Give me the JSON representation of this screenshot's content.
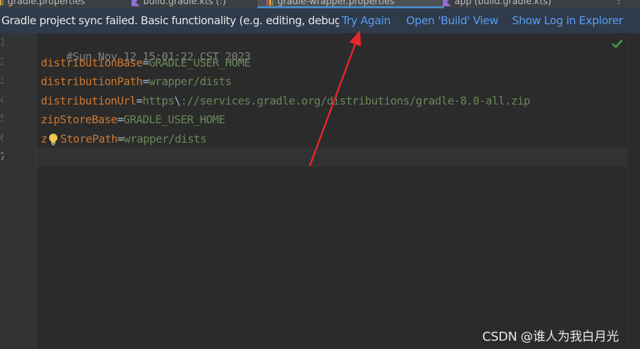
{
  "tabs": [
    {
      "label": "gradle.properties",
      "active": false
    },
    {
      "label": "build.gradle.kts (:)",
      "active": false
    },
    {
      "label": "gradle-wrapper.properties",
      "active": true
    },
    {
      "label": "app (build.gradle.kts)",
      "active": false
    }
  ],
  "banner": {
    "message": "Gradle project sync failed. Basic functionality (e.g. editing, debugging) will not work properly.",
    "try_again": "Try Again",
    "open_build_view": "Open 'Build' View",
    "show_log": "Show Log in Explorer"
  },
  "gutter": {
    "line_numbers": [
      "1",
      "2",
      "3",
      "4",
      "5",
      "6",
      "7"
    ],
    "current_line": 7
  },
  "code": {
    "line1": "#Sun Nov 12 15:01:22 CST 2023",
    "line2_key": "distributionBase",
    "line2_eq": "=",
    "line2_val": "GRADLE_USER_HOME",
    "line3_key": "distributionPath",
    "line3_eq": "=",
    "line3_val": "wrapper/dists",
    "line4_key": "distributionUrl",
    "line4_eq": "=",
    "line4_val_a": "https",
    "line4_escape": "\\",
    "line4_val_b": "://services.gradle.org/distributions/gradle-8.0-all.zip",
    "line5_key": "zipStoreBase",
    "line5_eq": "=",
    "line5_val": "GRADLE_USER_HOME",
    "line6_key_a": "z",
    "line6_key_b": "StorePath",
    "line6_eq": "=",
    "line6_val": "wrapper/dists"
  },
  "icons": {
    "status": "checkmark-icon",
    "intention": "lightbulb-icon",
    "annotation": "red-arrow"
  },
  "colors": {
    "key": "#cc7832",
    "value": "#6a8759",
    "comment": "#808080",
    "link": "#589df6",
    "arrow": "#e8262b",
    "check": "#499c54"
  },
  "watermark": "CSDN @谁人为我白月光"
}
